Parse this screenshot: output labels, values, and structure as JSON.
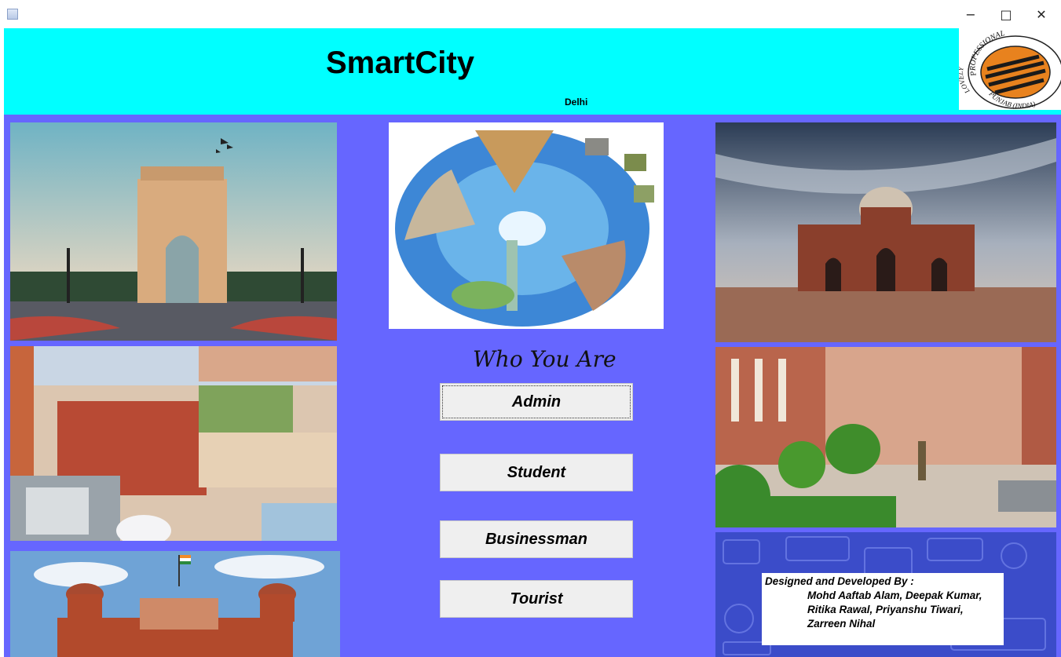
{
  "window": {
    "minimize_glyph": "−",
    "maximize_glyph": "□",
    "close_glyph": "✕"
  },
  "header": {
    "title": "SmartCity",
    "city": "Delhi",
    "logo_top_text": "PROFESSIONAL",
    "logo_left_text": "LOVELY",
    "logo_bottom_text": "PUNJAB (INDIA)"
  },
  "prompt": "Who You Are",
  "buttons": {
    "admin": "Admin",
    "student": "Student",
    "businessman": "Businessman",
    "tourist": "Tourist"
  },
  "credits": {
    "heading": "Designed and Developed By :",
    "line1": "Mohd Aaftab Alam, Deepak Kumar,",
    "line2": "Ritika Rawal, Priyanshu Tiwari,",
    "line3": "Zarreen Nihal"
  },
  "colors": {
    "header_bg": "#00ffff",
    "main_bg": "#6666ff",
    "button_bg": "#efefef"
  },
  "images": {
    "left_top": "india-gate-photo",
    "left_middle": "delhi-landmarks-collage",
    "left_bottom": "red-fort-photo",
    "center": "world-landmarks-puzzle",
    "right_top": "humayun-tomb-photo",
    "right_middle": "secretariat-building-photo",
    "right_bottom": "tech-pattern-background"
  }
}
